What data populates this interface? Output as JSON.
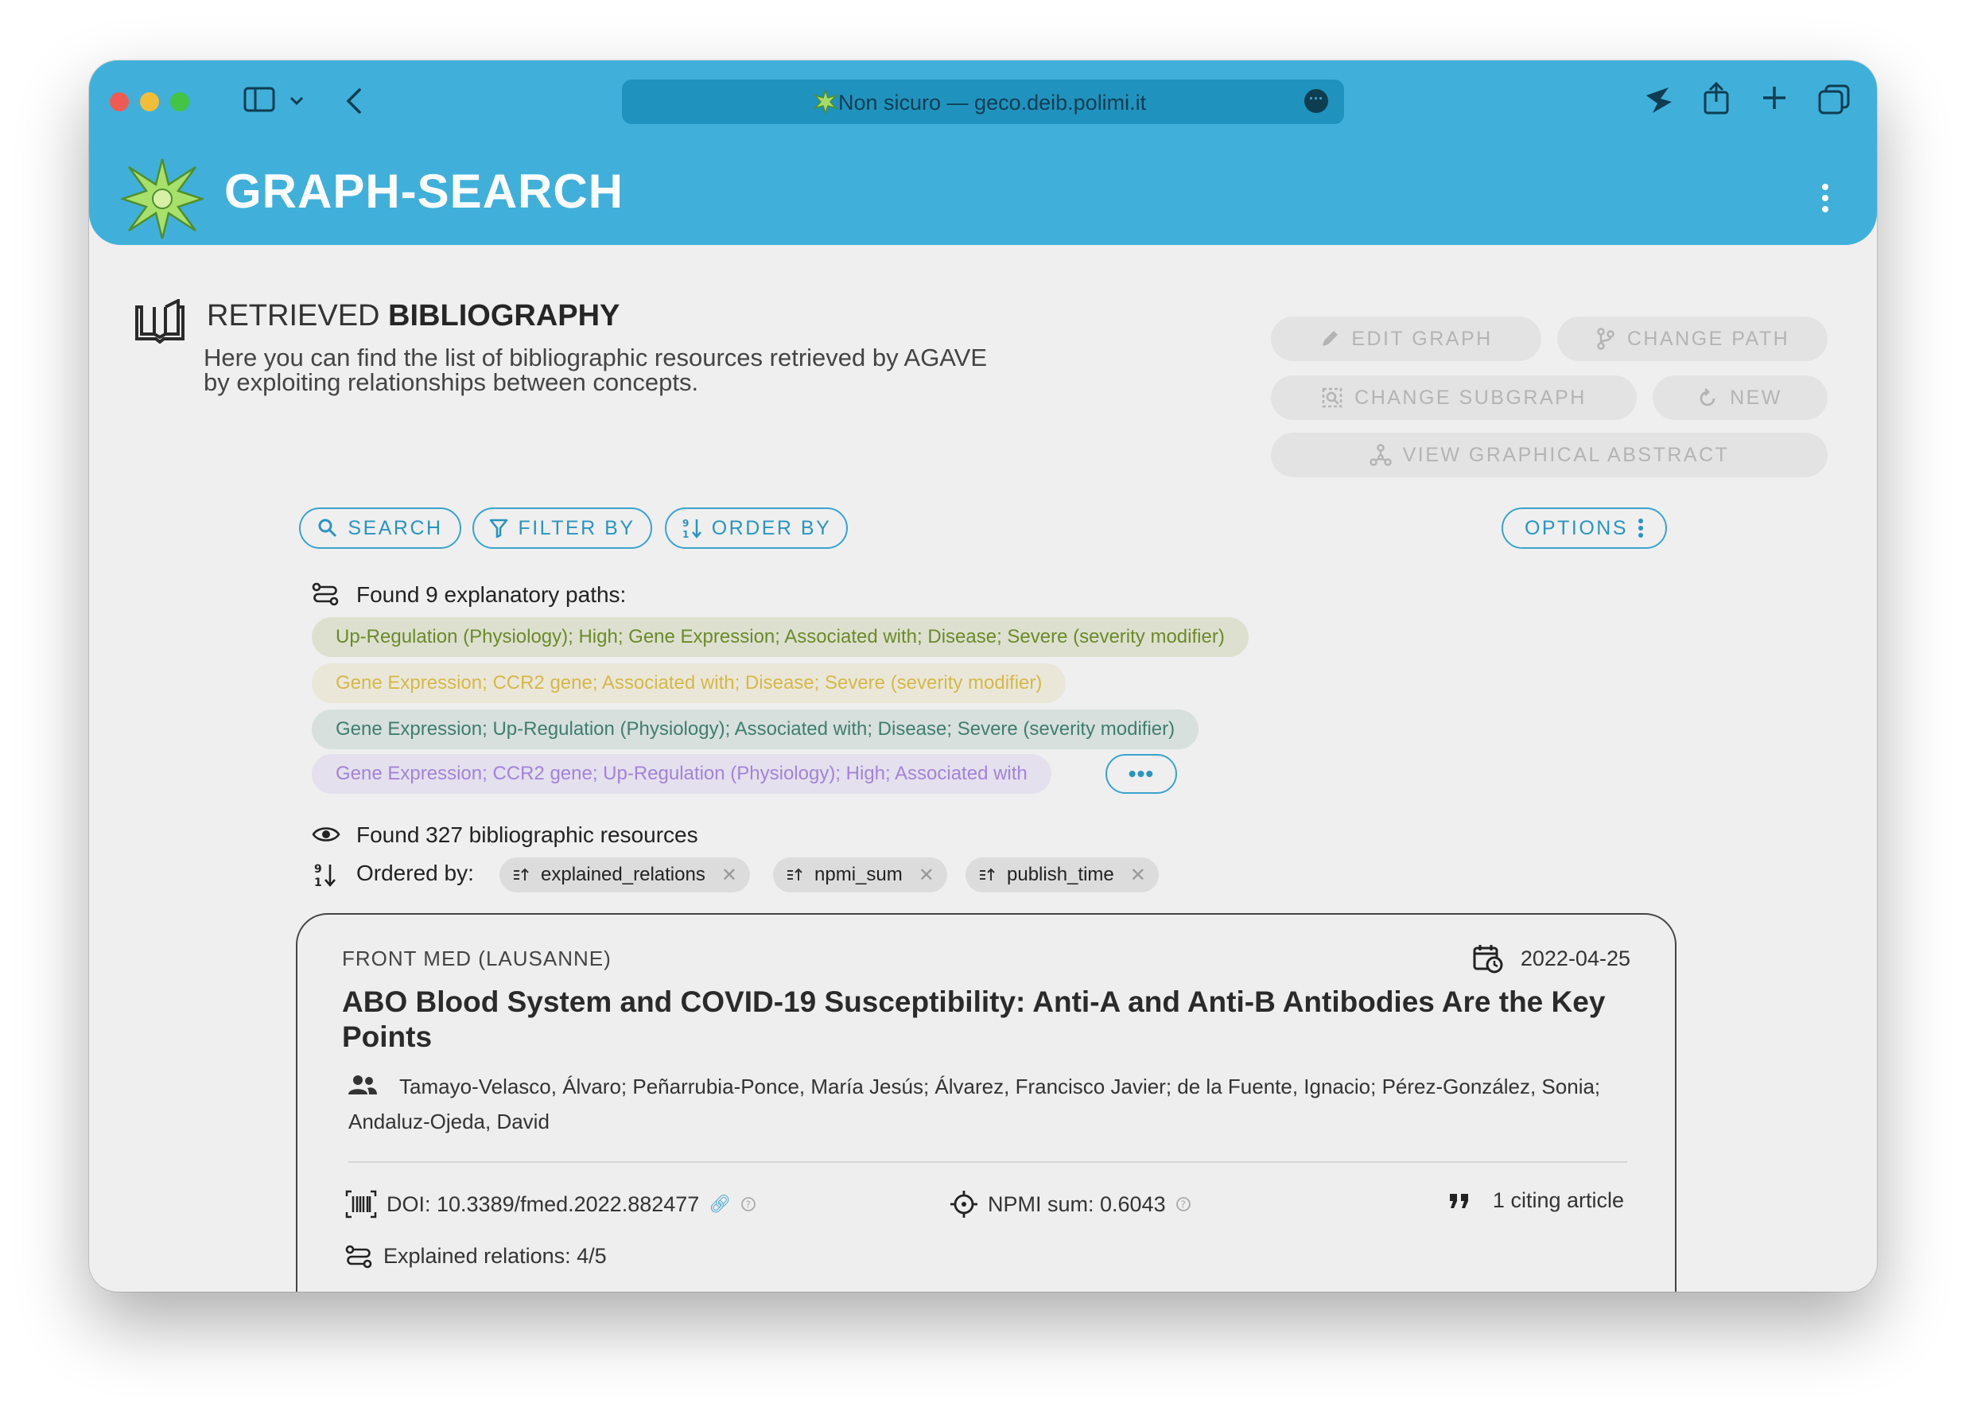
{
  "browser": {
    "url_text": "Non sicuro — geco.deib.polimi.it"
  },
  "app": {
    "title": "GRAPH-SEARCH"
  },
  "section": {
    "title_prefix": "RETRIEVED ",
    "title_bold": "BIBLIOGRAPHY",
    "description": "Here you can find the list of bibliographic resources retrieved by AGAVE by exploiting relationships between concepts."
  },
  "actions": {
    "edit_graph": "EDIT GRAPH",
    "change_path": "CHANGE PATH",
    "change_subgraph": "CHANGE SUBGRAPH",
    "new": "NEW",
    "view_graphical_abstract": "VIEW GRAPHICAL ABSTRACT"
  },
  "toolbar": {
    "search": "SEARCH",
    "filter_by": "FILTER BY",
    "order_by": "ORDER BY",
    "options": "OPTIONS"
  },
  "paths": {
    "found_label": "Found 9 explanatory paths:",
    "items": [
      {
        "text": "Up-Regulation (Physiology); High; Gene Expression; Associated with; Disease; Severe (severity modifier)",
        "color": "#6b8a2a",
        "bg": "#dde0cf"
      },
      {
        "text": "Gene Expression; CCR2 gene; Associated with; Disease; Severe (severity modifier)",
        "color": "#d4b84a",
        "bg": "#ebe7d8"
      },
      {
        "text": "Gene Expression; Up-Regulation (Physiology); Associated with; Disease; Severe (severity modifier)",
        "color": "#3f7d6e",
        "bg": "#d7e0dd"
      },
      {
        "text": "Gene Expression; CCR2 gene; Up-Regulation (Physiology); High; Associated with",
        "color": "#a383d8",
        "bg": "#e4e0ee"
      }
    ],
    "more_label": "•••"
  },
  "resources": {
    "found_label": "Found 327 bibliographic resources",
    "ordered_label": "Ordered by:",
    "order_chips": [
      "explained_relations",
      "npmi_sum",
      "publish_time"
    ]
  },
  "card": {
    "journal": "FRONT MED (LAUSANNE)",
    "date": "2022-04-25",
    "title": "ABO Blood System and COVID-19 Susceptibility: Anti-A and Anti-B Antibodies Are the Key Points",
    "authors": "Tamayo-Velasco, Álvaro; Peñarrubia-Ponce, María Jesús; Álvarez, Francisco Javier; de la Fuente, Ignacio; Pérez-González, Sonia; Andaluz-Ojeda, David",
    "doi": "DOI: 10.3389/fmed.2022.882477",
    "npmi": "NPMI sum: 0.6043",
    "citing": "1 citing article",
    "explained": "Explained relations: 4/5"
  }
}
